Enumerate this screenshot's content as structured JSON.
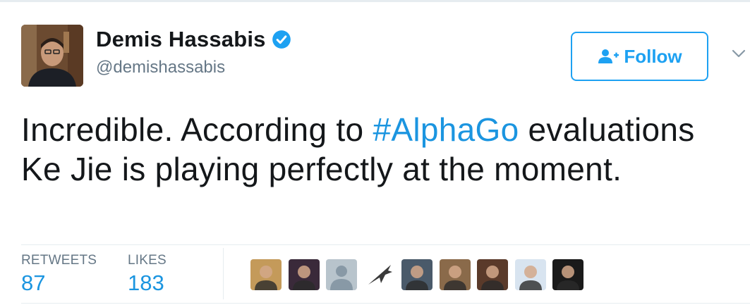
{
  "tweet": {
    "author": {
      "display_name": "Demis Hassabis",
      "screen_name": "@demishassabis",
      "verified": true,
      "avatar_icon": "profile-photo"
    },
    "follow_label": "Follow",
    "text_before": "Incredible. According to ",
    "hashtag": "#AlphaGo",
    "text_after": " evaluations Ke Jie is playing perfectly at the moment.",
    "stats": {
      "retweets_label": "RETWEETS",
      "retweets_count": "87",
      "likes_label": "LIKES",
      "likes_count": "183"
    },
    "likers": [
      {
        "icon": "liker-avatar-1",
        "color": "#c49a5a"
      },
      {
        "icon": "liker-avatar-2",
        "color": "#3a2a3a"
      },
      {
        "icon": "default-avatar-icon",
        "color": "#b8c4cc"
      },
      {
        "icon": "liker-avatar-4-jet",
        "color": "#ffffff"
      },
      {
        "icon": "liker-avatar-5",
        "color": "#4a5a6a"
      },
      {
        "icon": "liker-avatar-6",
        "color": "#8a6a4a"
      },
      {
        "icon": "liker-avatar-7",
        "color": "#5a3a2a"
      },
      {
        "icon": "liker-avatar-8",
        "color": "#d8e4f0"
      },
      {
        "icon": "liker-avatar-9",
        "color": "#1a1a1a"
      }
    ]
  },
  "colors": {
    "accent": "#1da1f2",
    "link": "#1b95e0",
    "text": "#14171a",
    "muted": "#657786"
  }
}
